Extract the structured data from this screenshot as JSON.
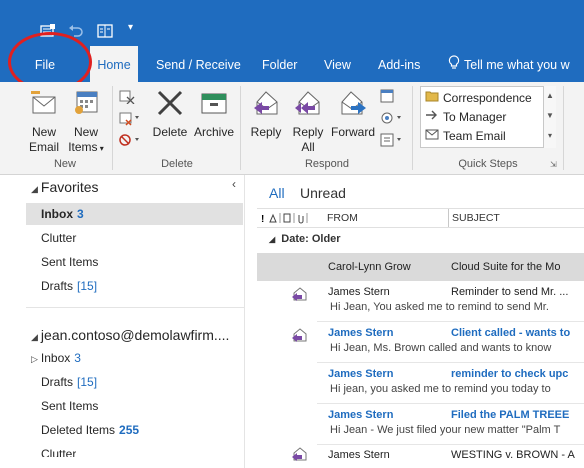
{
  "tabs": {
    "file": "File",
    "home": "Home",
    "send_receive": "Send / Receive",
    "folder": "Folder",
    "view": "View",
    "addins": "Add-ins",
    "tell_me": "Tell me what you w"
  },
  "ribbon": {
    "new_email": [
      "New",
      "Email"
    ],
    "new_items": [
      "New",
      "Items"
    ],
    "group_new": "New",
    "delete": "Delete",
    "archive": "Archive",
    "group_delete": "Delete",
    "reply": "Reply",
    "reply_all": [
      "Reply",
      "All"
    ],
    "forward": "Forward",
    "group_respond": "Respond",
    "quick_steps": [
      "Correspondence",
      "To Manager",
      "Team Email"
    ],
    "group_quick_steps": "Quick Steps"
  },
  "folders": {
    "favorites_label": "Favorites",
    "favorites": [
      {
        "name": "Inbox",
        "count": "3"
      },
      {
        "name": "Clutter",
        "count": ""
      },
      {
        "name": "Sent Items",
        "count": ""
      },
      {
        "name": "Drafts",
        "count": "[15]"
      }
    ],
    "account_label": "jean.contoso@demolawfirm....",
    "account": [
      {
        "name": "Inbox",
        "count": "3"
      },
      {
        "name": "Drafts",
        "count": "[15]"
      },
      {
        "name": "Sent Items",
        "count": ""
      },
      {
        "name": "Deleted Items",
        "count": "255"
      },
      {
        "name": "Clutter",
        "count": ""
      }
    ]
  },
  "list": {
    "filter_all": "All",
    "filter_unread": "Unread",
    "col_icons": "! △ | ▯ | ○",
    "col_from": "FROM",
    "col_subject": "SUBJECT",
    "group_label": "Date: Older",
    "messages": [
      {
        "from": "Carol-Lynn Grow",
        "subject": "Cloud Suite for the Mo",
        "preview": ""
      },
      {
        "from": "James Stern",
        "subject": "Reminder to send Mr. ...",
        "preview": "Hi Jean,  You asked me to remind to send Mr."
      },
      {
        "from": "James Stern",
        "subject": "Client called - wants to",
        "preview": "Hi Jean, Ms. Brown called and wants to know"
      },
      {
        "from": "James Stern",
        "subject": "reminder to check upc",
        "preview": "Hi jean, you asked me to remind you today to"
      },
      {
        "from": "James Stern",
        "subject": "Filed the PALM TREEE",
        "preview": "Hi Jean -  We just filed your new matter \"Palm T"
      },
      {
        "from": "James Stern",
        "subject": "WESTING v. BROWN - A",
        "preview": ""
      }
    ]
  },
  "colors": {
    "brand": "#1f6cbf",
    "ribbon_bg": "#f3f3f3",
    "highlight_circle": "#e02020"
  }
}
